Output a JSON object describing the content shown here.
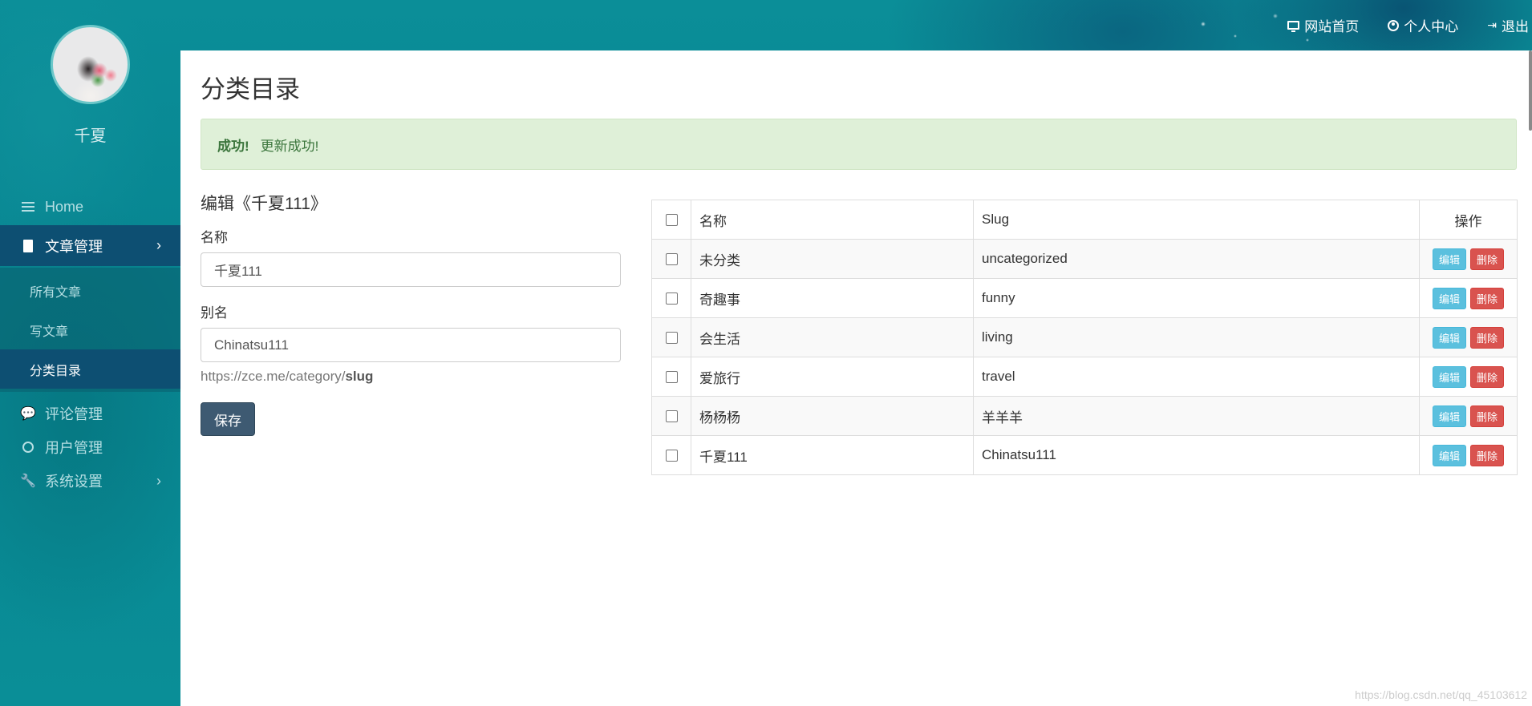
{
  "topnav": {
    "home_label": "网站首页",
    "profile_label": "个人中心",
    "logout_label": "退出"
  },
  "sidebar": {
    "username": "千夏",
    "items": [
      {
        "label": "Home",
        "icon": "list-icon"
      },
      {
        "label": "文章管理",
        "icon": "document-icon",
        "active": true
      },
      {
        "label": "评论管理",
        "icon": "comments-icon"
      },
      {
        "label": "用户管理",
        "icon": "user-circle-icon"
      },
      {
        "label": "系统设置",
        "icon": "wrench-icon"
      }
    ],
    "submenu": [
      {
        "label": "所有文章"
      },
      {
        "label": "写文章"
      },
      {
        "label": "分类目录",
        "active": true
      }
    ]
  },
  "page": {
    "title": "分类目录",
    "alert_strong": "成功!",
    "alert_text": "更新成功!"
  },
  "form": {
    "title": "编辑《千夏111》",
    "name_label": "名称",
    "name_value": "千夏111",
    "slug_label": "别名",
    "slug_value": "Chinatsu111",
    "slug_hint_prefix": "https://zce.me/category/",
    "slug_hint_bold": "slug",
    "save_label": "保存"
  },
  "table": {
    "headers": {
      "name": "名称",
      "slug": "Slug",
      "ops": "操作"
    },
    "edit_label": "编辑",
    "delete_label": "删除",
    "rows": [
      {
        "name": "未分类",
        "slug": "uncategorized"
      },
      {
        "name": "奇趣事",
        "slug": "funny"
      },
      {
        "name": "会生活",
        "slug": "living"
      },
      {
        "name": "爱旅行",
        "slug": "travel"
      },
      {
        "name": "杨杨杨",
        "slug": "羊羊羊"
      },
      {
        "name": "千夏111",
        "slug": "Chinatsu111"
      }
    ]
  },
  "watermark": "https://blog.csdn.net/qq_45103612",
  "colors": {
    "sidebar_active": "#0d4f72",
    "alert_bg": "#dff0d8",
    "edit_btn": "#5bc0de",
    "delete_btn": "#d9534f",
    "save_btn": "#3e5a72"
  }
}
